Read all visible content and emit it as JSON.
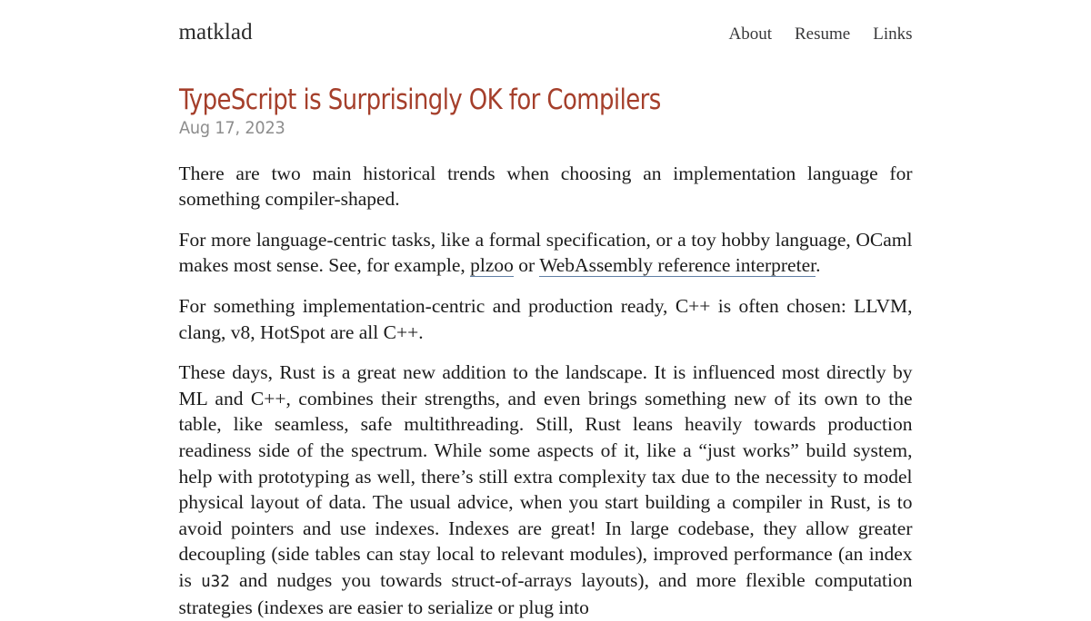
{
  "site": {
    "title": "matklad",
    "nav": [
      {
        "label": "About"
      },
      {
        "label": "Resume"
      },
      {
        "label": "Links"
      }
    ]
  },
  "article": {
    "title": "TypeScript is Surprisingly OK for Compilers",
    "date": "Aug 17, 2023",
    "paragraphs": {
      "p1": "There are two main historical trends when choosing an implementation language for something compiler-shaped.",
      "p2_a": "For more language-centric tasks, like a formal specification, or a toy hobby language, OCaml makes most sense. See, for example, ",
      "p2_link1": "plzoo",
      "p2_b": " or ",
      "p2_link2": "WebAssembly reference interpreter",
      "p2_c": ".",
      "p3": "For something implementation-centric and production ready, C++ is often chosen: LLVM, clang, v8, HotSpot are all C++.",
      "p4_a": "These days, Rust is a great new addition to the landscape. It is influenced most directly by ML and C++, combines their strengths, and even brings something new of its own to the table, like seamless, safe multithreading. Still, Rust leans heavily towards production readiness side of the spectrum. While some aspects of it, like a “just works” build system, help with prototyping as well, there’s still extra complexity tax due to the necessity to model physical layout of data. The usual advice, when you start building a compiler in Rust, is to avoid pointers and use indexes. Indexes are great! In large codebase, they allow greater decoupling (side tables can stay local to relevant modules), improved performance (an index is ",
      "p4_code": "u32",
      "p4_b": " and nudges you towards struct-of-arrays layouts), and more flexible computation strategies (indexes are easier to serialize or plug into"
    }
  },
  "colors": {
    "title_accent": "#a53f2b",
    "date_muted": "#8d8d8d",
    "body_text": "#1b1b1b",
    "link_underline": "#5f7fa6",
    "background": "#ffffff"
  }
}
